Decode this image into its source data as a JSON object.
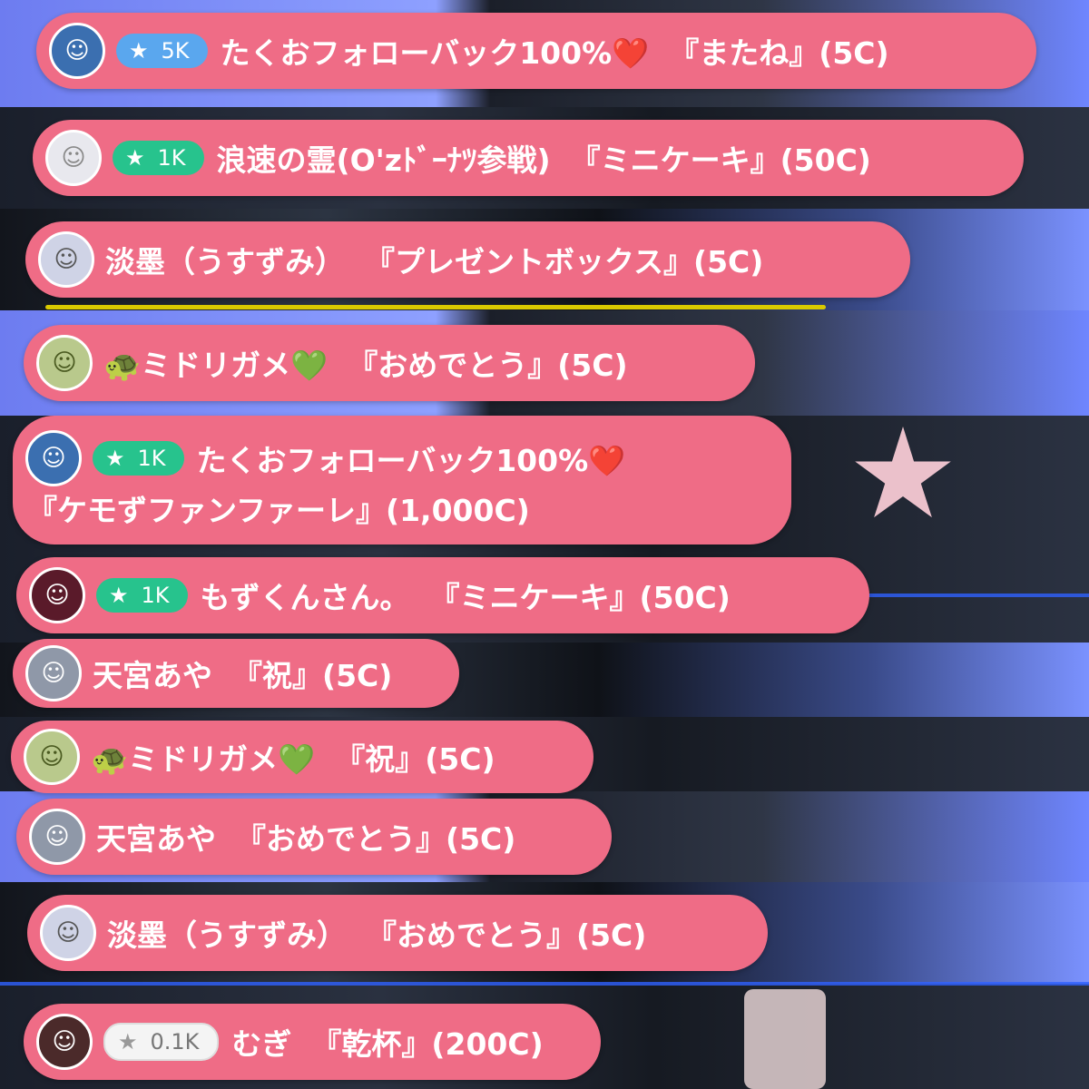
{
  "colors": {
    "pill": "#ef6c86",
    "badge_blue": "#5aa7ee",
    "badge_green": "#27c38d",
    "badge_white": "#f4f4f4",
    "accent_blue": "#2f62ff"
  },
  "comments": [
    {
      "avatar_icon": "boy-avatar-icon",
      "badge": "5K",
      "badge_style": "blue",
      "name": "たくおフォローバック100%❤️",
      "gift": "『またね』(5C)"
    },
    {
      "avatar_icon": "white-hair-girl-avatar-icon",
      "badge": "1K",
      "badge_style": "green",
      "name": "浪速の霊(O'zﾄﾞｰﾅﾂ参戦)",
      "gift": "『ミニケーキ』(50C)"
    },
    {
      "avatar_icon": "glasses-avatar-icon",
      "name": "淡墨（うすずみ）",
      "gift": "『プレゼントボックス』(5C)"
    },
    {
      "avatar_icon": "green-hair-avatar-icon",
      "name": "🐢ミドリガメ💚",
      "gift": "『おめでとう』(5C)"
    },
    {
      "avatar_icon": "boy-avatar-icon",
      "badge": "1K",
      "badge_style": "green",
      "name": "たくおフォローバック100%❤️",
      "gift": "『ケモずファンファーレ』(1,000C)"
    },
    {
      "avatar_icon": "shark-avatar-icon",
      "badge": "1K",
      "badge_style": "green",
      "name": "もずくんさん。",
      "gift": "『ミニケーキ』(50C)"
    },
    {
      "avatar_icon": "gray-hair-avatar-icon",
      "name": "天宮あや",
      "gift": "『祝』(5C)"
    },
    {
      "avatar_icon": "green-hair-avatar-icon",
      "name": "🐢ミドリガメ💚",
      "gift": "『祝』(5C)"
    },
    {
      "avatar_icon": "gray-hair-avatar-icon",
      "name": "天宮あや",
      "gift": "『おめでとう』(5C)"
    },
    {
      "avatar_icon": "glasses-avatar-icon",
      "name": "淡墨（うすずみ）",
      "gift": "『おめでとう』(5C)"
    },
    {
      "avatar_icon": "dark-hair-girl-avatar-icon",
      "badge": "0.1K",
      "badge_style": "white",
      "name": "むぎ",
      "gift": "『乾杯』(200C)"
    }
  ],
  "badge_star_glyph": "★"
}
